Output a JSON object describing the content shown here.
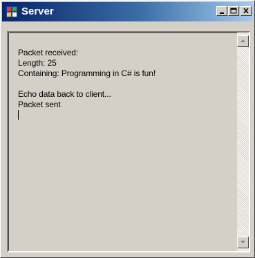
{
  "window": {
    "title": "Server"
  },
  "output": {
    "lines": [
      "Packet received:",
      "Length: 25",
      "Containing: Programming in C# is fun!",
      "",
      "Echo data back to client...",
      "Packet sent"
    ]
  },
  "icons": {
    "app": "app-window-icon",
    "minimize": "minimize-icon",
    "maximize": "maximize-icon",
    "close": "close-icon",
    "scroll_up": "scroll-up-icon",
    "scroll_down": "scroll-down-icon"
  },
  "colors": {
    "titlebar_start": "#0a246a",
    "titlebar_end": "#a6caf0",
    "face": "#d4d0c8"
  }
}
